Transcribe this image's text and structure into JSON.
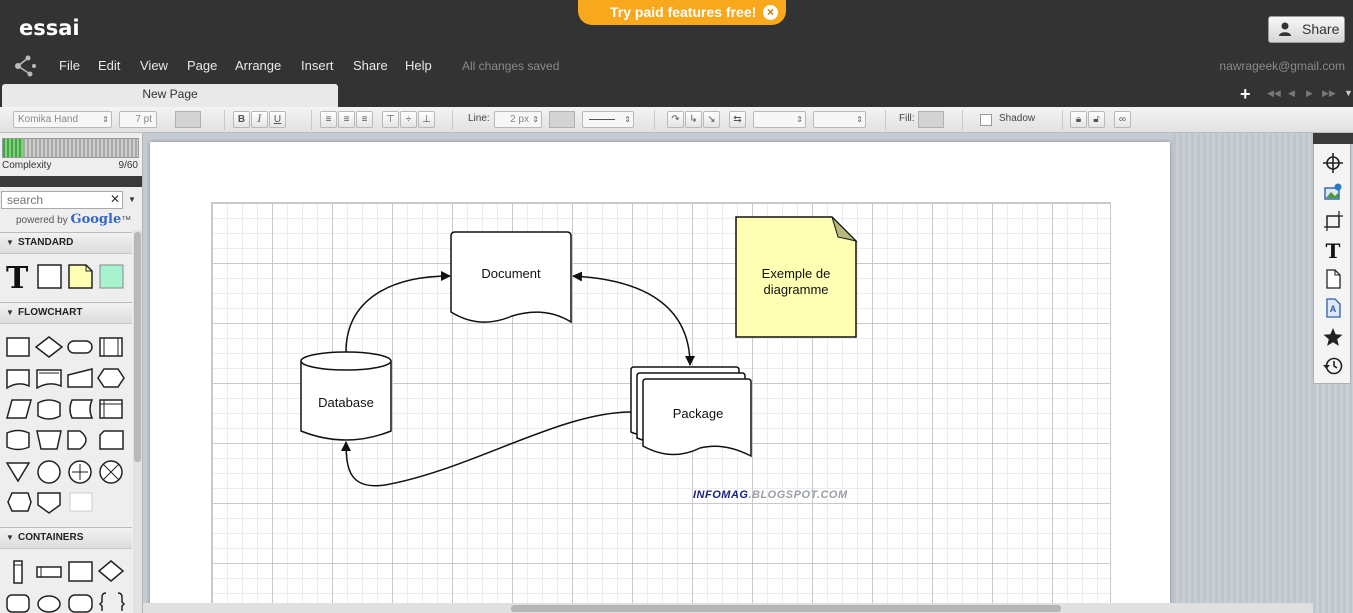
{
  "header": {
    "doc_title": "essai",
    "promo_text": "Try paid features free!",
    "promo_close": "×",
    "share_label": "Share",
    "menu": [
      "File",
      "Edit",
      "View",
      "Page",
      "Arrange",
      "Insert",
      "Share",
      "Help"
    ],
    "save_status": "All changes saved",
    "user_email": "nawrageek@gmail.com"
  },
  "tabs": {
    "active_label": "New Page",
    "add_label": "+"
  },
  "toolbar": {
    "font_family": "Komika Hand",
    "font_size": "7 pt",
    "bold": "B",
    "italic": "I",
    "underline": "U",
    "line_label": "Line:",
    "line_width": "2 px",
    "fill_label": "Fill:",
    "shadow_label": "Shadow"
  },
  "left_panel": {
    "complexity_label": "Complexity",
    "complexity_count": "9/60",
    "complexity_fraction": 0.15,
    "search_placeholder": "search",
    "search_clear": "✕",
    "powered_prefix": "powered by",
    "powered_brand": "Google",
    "powered_tm": "™",
    "sections": [
      "STANDARD",
      "FLOWCHART",
      "CONTAINERS"
    ]
  },
  "diagram": {
    "nodes": {
      "document": "Document",
      "database": "Database",
      "package": "Package",
      "note_line1": "Exemple de",
      "note_line2": "diagramme"
    },
    "watermark_part1": "INFOMAG",
    "watermark_part2": ".BLOGSPOT.COM",
    "note_color": "#ffffb3"
  },
  "colors": {
    "header_bg": "#333333",
    "promo_bg": "#f7a81c",
    "complexity_green": "#43a547",
    "standard_swatch": "#a7f3d0"
  }
}
